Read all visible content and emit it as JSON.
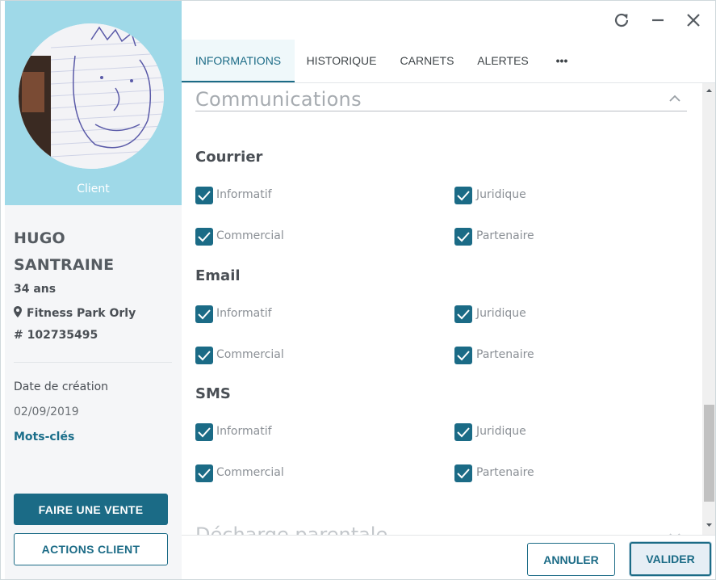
{
  "profile": {
    "role_label": "Client",
    "first_name": "HUGO",
    "last_name": "SANTRAINE",
    "age": "34 ans",
    "location": "Fitness Park Orly",
    "member_id": "# 102735495",
    "creation_date_label": "Date de création",
    "creation_date": "02/09/2019",
    "keywords_link": "Mots-clés",
    "sell_button": "FAIRE UNE VENTE",
    "actions_button": "ACTIONS CLIENT"
  },
  "window_controls": {
    "icons": [
      "refresh-icon",
      "minimize-icon",
      "close-icon"
    ]
  },
  "tabs": [
    {
      "label": "INFORMATIONS",
      "active": true
    },
    {
      "label": "HISTORIQUE",
      "active": false
    },
    {
      "label": "CARNETS",
      "active": false
    },
    {
      "label": "ALERTES",
      "active": false
    },
    {
      "label": "•••",
      "active": false
    }
  ],
  "communications": {
    "title": "Communications",
    "groups": [
      {
        "title": "Courrier",
        "options": [
          {
            "label": "Informatif",
            "checked": true
          },
          {
            "label": "Juridique",
            "checked": true
          },
          {
            "label": "Commercial",
            "checked": true
          },
          {
            "label": "Partenaire",
            "checked": true
          }
        ]
      },
      {
        "title": "Email",
        "options": [
          {
            "label": "Informatif",
            "checked": true
          },
          {
            "label": "Juridique",
            "checked": true
          },
          {
            "label": "Commercial",
            "checked": true
          },
          {
            "label": "Partenaire",
            "checked": true
          }
        ]
      },
      {
        "title": "SMS",
        "options": [
          {
            "label": "Informatif",
            "checked": true
          },
          {
            "label": "Juridique",
            "checked": true
          },
          {
            "label": "Commercial",
            "checked": true
          },
          {
            "label": "Partenaire",
            "checked": true
          }
        ]
      }
    ]
  },
  "next_section": {
    "title": "Décharge parentale"
  },
  "footer": {
    "cancel_label": "ANNULER",
    "validate_label": "VALIDER"
  },
  "colors": {
    "accent": "#1b6b86",
    "profile_header": "#9fd9e8",
    "sidebar_bg": "#f5f6f8"
  }
}
